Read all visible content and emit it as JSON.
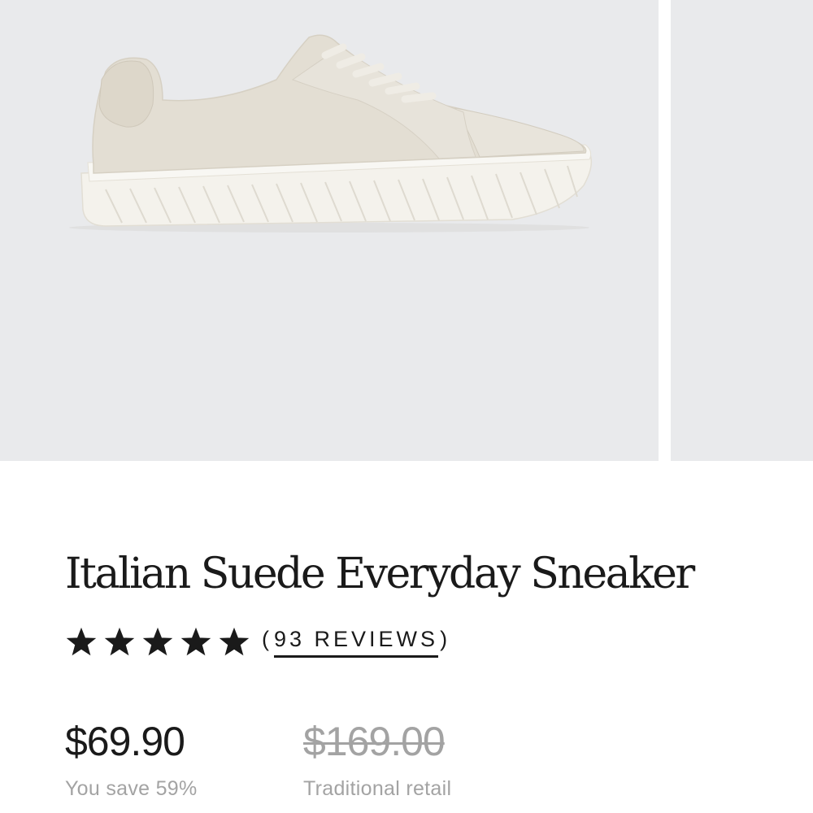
{
  "product": {
    "title": "Italian Suede Everyday Sneaker",
    "rating": {
      "stars": 5,
      "stars_filled": 5,
      "open_paren": "(",
      "reviews_label": "93 REVIEWS",
      "close_paren": ")"
    },
    "price": {
      "sale": "$69.90",
      "sale_note": "You save 59%",
      "retail": "$169.00",
      "retail_note": "Traditional retail"
    }
  },
  "colors": {
    "gallery_background": "#e9eaec",
    "text": "#1a1a1a",
    "muted_text": "#a3a3a3",
    "shoe_suede": "#e3ded3"
  },
  "icons": {
    "star": "star-icon"
  }
}
